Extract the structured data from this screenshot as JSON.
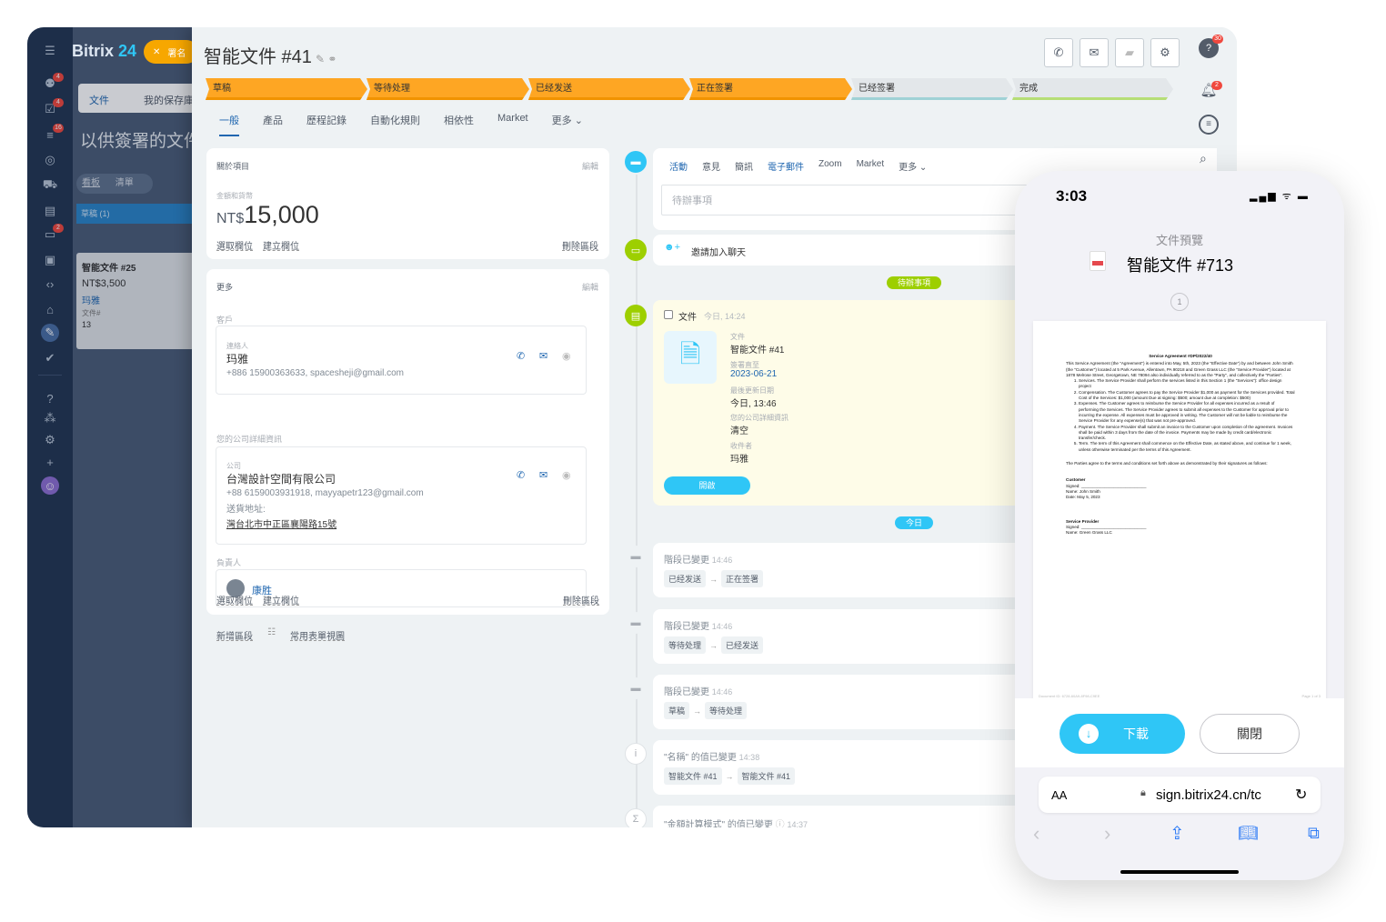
{
  "left_nav": {
    "brand_main": "Bitrix",
    "brand_num": "24",
    "sign_label": "署名",
    "badges": [
      "4",
      "4",
      "16",
      "",
      "",
      "",
      "2"
    ]
  },
  "behind": {
    "tab_docs": "文件",
    "tab_saved": "我的保存庫",
    "page_title": "以供簽署的文件",
    "view_board": "看板",
    "view_list": "清單",
    "column": "草稿 (1)",
    "card": {
      "title": "智能文件 #25",
      "amount": "NT$3,500",
      "person": "玛雅",
      "meta": "文件#",
      "num": "13"
    }
  },
  "header": {
    "title": "智能文件 #41"
  },
  "stages": [
    "草稿",
    "等待处理",
    "已经发送",
    "正在签署",
    "已经签署",
    "完成"
  ],
  "tabs": [
    "一般",
    "產品",
    "歷程記錄",
    "自動化規則",
    "相依性",
    "Market",
    "更多"
  ],
  "about": {
    "title": "關於項目",
    "edit": "編輯",
    "amount_label": "金額和貨幣",
    "currency": "NT$",
    "amount": "15,000",
    "select_field": "選取欄位",
    "create_field": "建立欄位",
    "delete_section": "刪除區段"
  },
  "more": {
    "title": "更多",
    "edit": "編輯",
    "client_label": "客戶",
    "contact": {
      "sub": "連絡人",
      "name": "玛雅",
      "details": "+886 15900363633, spacesheji@gmail.com"
    },
    "company_label": "您的公司詳細資訊",
    "company": {
      "sub": "公司",
      "name": "台灣設計空間有限公司",
      "details": "+88 6159003931918, mayyapetr123@gmail.com",
      "addr_label": "送貨地址:",
      "addr": "灣台北市中正區襄陽路15號"
    },
    "owner_label": "負責人",
    "owner": "康胜",
    "select_field": "選取欄位",
    "create_field": "建立欄位",
    "delete_section": "刪除區段"
  },
  "footer_links": {
    "add_section": "新增區段",
    "common_view": "常用表單視圖"
  },
  "activity": {
    "tabs": [
      "活動",
      "意見",
      "簡訊",
      "電子郵件",
      "Zoom",
      "Market",
      "更多"
    ],
    "todo_placeholder": "待辦事項",
    "invite": "邀請加入聊天",
    "todo_pill": "待辦事項",
    "today_pill": "今日",
    "doc": {
      "head": "文件",
      "time": "今日, 14:24",
      "l1": "文件",
      "v1": "智能文件 #41",
      "l2": "簽署直至",
      "v2": "2023-06-21",
      "l3": "最後更新日期",
      "v3": "今日, 13:46",
      "l4": "您的公司詳細資訊",
      "v4": "清空",
      "l5": "收件者",
      "v5": "玛雅",
      "open": "開啟"
    },
    "history": [
      {
        "title": "階段已變更",
        "time": "14:46",
        "from": "已经发送",
        "to": "正在签署"
      },
      {
        "title": "階段已變更",
        "time": "14:46",
        "from": "等待处理",
        "to": "已经发送"
      },
      {
        "title": "階段已變更",
        "time": "14:46",
        "from": "草稿",
        "to": "等待处理"
      },
      {
        "title": "\"名稱\" 的值已變更",
        "time": "14:38",
        "from": "智能文件 #41",
        "to": "智能文件 #41"
      },
      {
        "title": "\"金額計算模式\" 的值已變更",
        "time": "14:37"
      }
    ]
  },
  "right_rail": {
    "badge_top": "30",
    "badge_bell": "2"
  },
  "phone": {
    "time": "3:03",
    "preview_label": "文件預覽",
    "doc_title": "智能文件 #713",
    "page_num": "1",
    "doc": {
      "heading": "Service Agreement #DP/2022/40",
      "intro": "This Service Agreement (the \"Agreement\") is entered into May, 5th, 2023 (the \"Effective Date\") by and between John Smith (the \"Customer\") located at 5 Park Avenue, Allentown, PA 90218 and Green Grass LLC (the \"Service Provider\") located at 1878 Melrose Street, Georgetown, NE 78094 also individually referred to as the \"Party\", and collectively the \"Parties\".",
      "items": [
        "Services. The Service Provider shall perform the services listed in this Section 1 (the \"Services\"): office design project",
        "Compensation. The Customer agrees to pay the Service Provider $1,000 as payment for the Services provided. Total Cost of the Services: $1,000 (amount Due at signing: $500; amount due at completion: $500)",
        "Expenses. The Customer agrees to reimburse the Service Provider for all expenses incurred as a result of performing the Services. The Service Provider agrees to submit all expenses to the Customer for approval prior to incurring the expense. All expenses must be approved in writing. The Customer will not be liable to reimburse the Service Provider for any expense(s) that was not pre-approved.",
        "Payment. The Service Provider shall submit an invoice to the Customer upon completion of the agreement. Invoices shall be paid within 3 days from the date of the invoice. Payments may be made by credit card/electronic transfer/check.",
        "Term. The term of this Agreement shall commence on the Effective Date, as stated above, and continue for 1 week, unless otherwise terminated per the terms of this Agreement."
      ],
      "closing": "The Parties agree to the terms and conditions set forth above as demonstrated by their signatures as follows:",
      "customer": "Customer",
      "signed": "Signed:",
      "cust_name": "Name: John Smith",
      "cust_date": "Date: May 5, 2023",
      "provider": "Service Provider",
      "signed2": "Signed:",
      "prov_name": "Name: Green Grass LLC",
      "footer_left": "Document ID: 6728-60A9-8F98-C9EE",
      "footer_right": "Page 1 of 3"
    },
    "download": "下載",
    "close": "關閉",
    "aa": "AA",
    "url": "sign.bitrix24.cn/tc"
  }
}
